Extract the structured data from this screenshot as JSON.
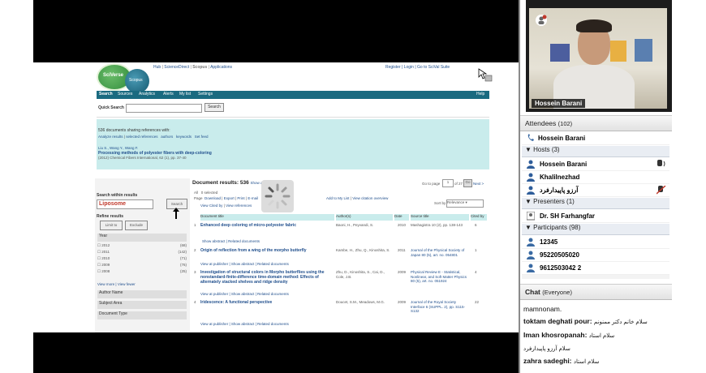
{
  "webpage": {
    "header_links": [
      "Hub",
      "ScienceDirect",
      "Scopus",
      "Applications"
    ],
    "right_links": "Register | Login | Go to SciVal Suite",
    "logo_sciverse": "SciVerse",
    "logo_scopus": "Scopus",
    "nav": [
      "Search",
      "Sources",
      "Analytics",
      "Alerts",
      "My list",
      "Settings"
    ],
    "help": "Help",
    "quick_search_label": "Quick Search",
    "quick_search_button": "Search",
    "sharing_line": "536 documents sharing references with:",
    "sharing_actions": [
      "Analyze results",
      "selected references",
      "authors",
      "keywords",
      "Set feed"
    ],
    "authors": "Liu S., Wang Y., Wang F.",
    "doc_title": "Processing methods of polyester fibers with deep-coloring",
    "doc_source": "(2012) Chemical Fibers International, 62 (1), pp. 37-40",
    "search_within": "Search within results",
    "search_term": "Liposome",
    "search_btn": "Search",
    "refine": "Refine results",
    "limit_btn": "Limit to",
    "exclude_btn": "Exclude",
    "year_label": "Year",
    "years": [
      {
        "y": "2012",
        "c": "(68)"
      },
      {
        "y": "2011",
        "c": "(142)"
      },
      {
        "y": "2010",
        "c": "(71)"
      },
      {
        "y": "2009",
        "c": "(76)"
      },
      {
        "y": "2008",
        "c": "(25)"
      }
    ],
    "view_more": "View more | View fewer",
    "facets": [
      "Author Name",
      "Subject Area",
      "Document Type"
    ],
    "results_title": "Document results: 536",
    "show_abstracts": "Show all abstracts",
    "goto_page": "Go to page",
    "page_num": "1",
    "of_pages": "of 27",
    "go": "Go",
    "next": "Next >",
    "sort_by": "Sort by",
    "sort_value": "Relevance",
    "toolbar": [
      "All",
      "Page",
      "0 selected",
      "Download",
      "Export",
      "Print",
      "E-mail",
      "Add to My List",
      "View citation overview",
      "View Cited by",
      "View references"
    ],
    "cols": [
      "Document title",
      "Author(s)",
      "Date",
      "Source title",
      "Cited by"
    ],
    "rows": [
      {
        "n": "1",
        "title": "Enhanced deep coloring of micro-polyester fabric",
        "authors": "Baoni, H., Peyvandi, S.",
        "date": "2010",
        "source": "Mashagistra 10 (2), pp. 138-143",
        "cited": "6",
        "links": "Show abstract | Related documents"
      },
      {
        "n": "2",
        "title": "Origin of reflection from a wing of the morpho butterfly",
        "authors": "Kambe, H., Zhu, Q., Kinoshita, S.",
        "date": "2011",
        "source": "Journal of the Physical Society of Japan 80 (5), art. no. 054801",
        "cited": "1",
        "links": "View at publisher | Show abstract | Related documents"
      },
      {
        "n": "3",
        "title": "Investigation of structural colors in Morpho butterflies using the nonstandard-finite-difference time-domain method: Effects of alternately stacked shelves and ridge density",
        "authors": "Zhu, D., Kinoshita, S., Cai, D., Cole, J.B.",
        "date": "2009",
        "source": "Physical Review E - Statistical, Nonlinear, and Soft Matter Physics 80 (5), art. no. 051924",
        "cited": "4",
        "links": "View at publisher | Show abstract | Related documents"
      },
      {
        "n": "4",
        "title": "Iridescence: A functional perspective",
        "authors": "Doucet, S.M., Meadows, M.G.",
        "date": "2009",
        "source": "Journal of the Royal Society Interface 6 (SUPPL. 2), pp. S115-S132",
        "cited": "22",
        "links": "View at publisher | Show abstract | Related documents"
      }
    ]
  },
  "video": {
    "name": "Hossein Barani"
  },
  "attendees": {
    "title": "Attendees",
    "count": "(102)",
    "self": "Hossein Barani",
    "hosts_label": "Hosts (3)",
    "hosts": [
      "Hossein Barani",
      "Khalilnezhad",
      "آرزو پاپيدارفرد"
    ],
    "presenters_label": "Presenters (1)",
    "presenters": [
      "Dr. SH Farhangfar"
    ],
    "participants_label": "Participants (98)",
    "participants": [
      "12345",
      "95220505020",
      "9612503042 2"
    ]
  },
  "chat": {
    "title": "Chat",
    "scope": "(Everyone)",
    "messages": [
      {
        "sender": "",
        "text": "mamnonam."
      },
      {
        "sender": "toktam deghati pour:",
        "text": "سلام خانم دکتر ممنونم"
      },
      {
        "sender": "Iman khosropanah:",
        "text": "سلام استاد"
      },
      {
        "sender": "",
        "text": "سلام آرزو پاپيدارفرد"
      },
      {
        "sender": "zahra sadeghi:",
        "text": "سلام استاد"
      }
    ]
  },
  "colors": {
    "nav": "#1a6a80",
    "teal": "#c9ecec",
    "link": "#1f4e8c"
  }
}
